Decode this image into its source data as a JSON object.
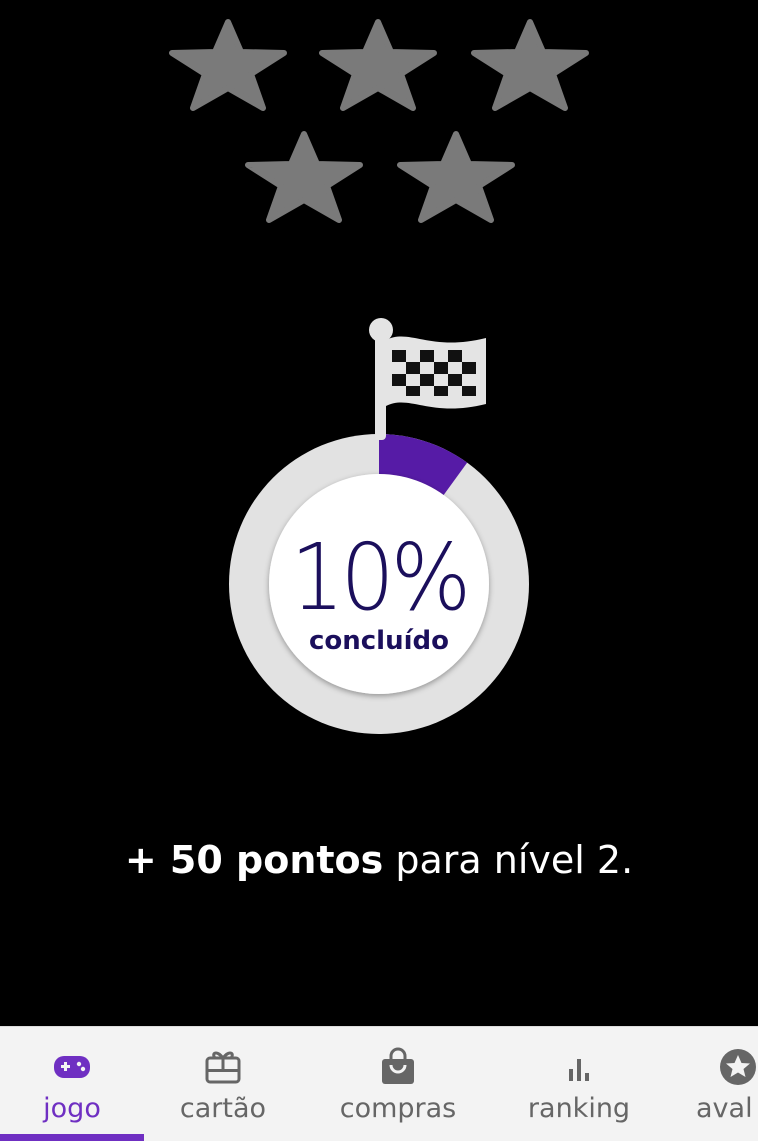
{
  "stars": {
    "count": 5,
    "filled": 0,
    "color": "#7a7a7a"
  },
  "progress": {
    "percent_value": 10,
    "percent_text": "10%",
    "label": "concluído",
    "ring_color": "#e2e2e2",
    "fill_color": "#561ba6",
    "text_color": "#1b0f5c",
    "flag_icon": "checkered-flag-icon"
  },
  "message": {
    "bold": "+ 50 pontos",
    "normal": " para nível 2."
  },
  "navbar": {
    "accent": "#6f2fc2",
    "items": [
      {
        "label": "jogo",
        "icon": "gamepad-icon",
        "active": true
      },
      {
        "label": "cartão",
        "icon": "gift-card-icon",
        "active": false
      },
      {
        "label": "compras",
        "icon": "shopping-bag-icon",
        "active": false
      },
      {
        "label": "ranking",
        "icon": "bar-chart-icon",
        "active": false
      },
      {
        "label": "aval",
        "icon": "star-circle-icon",
        "active": false
      }
    ]
  }
}
